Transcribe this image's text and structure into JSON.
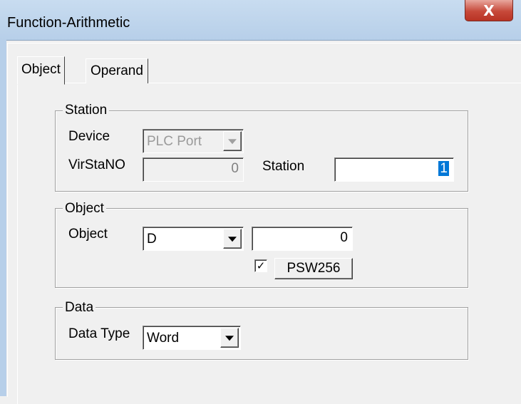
{
  "window": {
    "title": "Function-Arithmetic",
    "close_glyph": "X"
  },
  "tabs": [
    {
      "label": "Object",
      "active": true
    },
    {
      "label": "Operand",
      "active": false
    }
  ],
  "station": {
    "group_label": "Station",
    "device_label": "Device",
    "device_value": "PLC Port",
    "virstano_label": "VirStaNO",
    "virstano_value": "0",
    "station_label": "Station",
    "station_value": "1"
  },
  "object": {
    "group_label": "Object",
    "object_label": "Object",
    "object_type": "D",
    "object_address": "0",
    "psw_checked": true,
    "check_glyph": "✓",
    "psw_button": "PSW256"
  },
  "data": {
    "group_label": "Data",
    "data_type_label": "Data Type",
    "data_type_value": "Word"
  },
  "colors": {
    "titlebar": "#b7cfe9",
    "close_button": "#c7493a",
    "selection": "#0078d7"
  },
  "icons": {
    "close": "close-icon",
    "dropdown": "chevron-down-icon",
    "check": "checkmark-icon"
  }
}
